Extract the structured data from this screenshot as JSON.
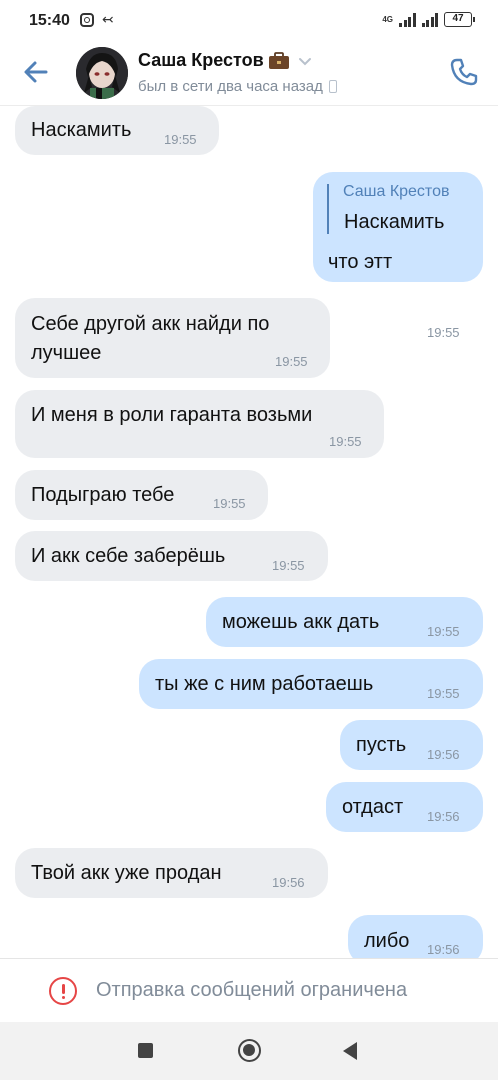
{
  "statusbar": {
    "time": "15:40",
    "network": "4G",
    "battery": "47"
  },
  "header": {
    "name": "Саша Крестов",
    "status": "был в сети два часа назад"
  },
  "messages": [
    {
      "dir": "in",
      "text": "Наскамить",
      "time": "19:55"
    },
    {
      "dir": "out",
      "reply_name": "Саша Крестов",
      "reply_text": "Наскамить",
      "text": "что этт",
      "time": "19:55"
    },
    {
      "dir": "in",
      "line1": "Себе другой акк найди по",
      "line2": "лучшее",
      "time": "19:55"
    },
    {
      "dir": "in",
      "text": "И меня в роли гаранта возьми",
      "time": "19:55"
    },
    {
      "dir": "in",
      "text": "Подыграю тебе",
      "time": "19:55"
    },
    {
      "dir": "in",
      "text": "И акк себе заберёшь",
      "time": "19:55"
    },
    {
      "dir": "out",
      "text": "можешь акк дать",
      "time": "19:55"
    },
    {
      "dir": "out",
      "text": "ты же с ним работаешь",
      "time": "19:55"
    },
    {
      "dir": "out",
      "text": "пусть",
      "time": "19:56"
    },
    {
      "dir": "out",
      "text": "отдаст",
      "time": "19:56"
    },
    {
      "dir": "in",
      "text": "Твой акк уже продан",
      "time": "19:56"
    },
    {
      "dir": "out",
      "text": "либо",
      "time": "19:56"
    }
  ],
  "footer": {
    "restriction": "Отправка сообщений ограничена"
  },
  "colors": {
    "accent": "#5181b8",
    "incoming_bubble": "#ebedf0",
    "outgoing_bubble": "#cce4ff",
    "warning": "#e64646"
  }
}
